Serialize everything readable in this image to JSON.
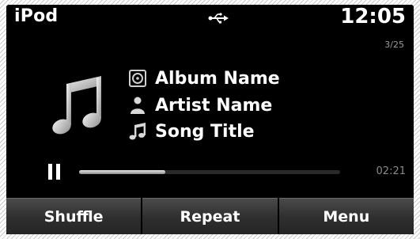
{
  "header": {
    "title": "iPod",
    "source_icon": "usb-icon",
    "clock": "12:05",
    "track_count": "3/25"
  },
  "now_playing": {
    "album_art_icon": "music-note-icon",
    "album": {
      "icon": "album-icon",
      "label": "Album Name"
    },
    "artist": {
      "icon": "artist-icon",
      "label": "Artist Name"
    },
    "song": {
      "icon": "song-note-icon",
      "label": "Song Title"
    }
  },
  "playback": {
    "state_icon": "pause-icon",
    "progress_fraction": 0.33,
    "elapsed": "02:21"
  },
  "softkeys": [
    {
      "label": "Shuffle"
    },
    {
      "label": "Repeat"
    },
    {
      "label": "Menu"
    }
  ],
  "colors": {
    "screen_background": "#000000",
    "text": "#ffffff",
    "muted_text": "#9a9a9a"
  }
}
